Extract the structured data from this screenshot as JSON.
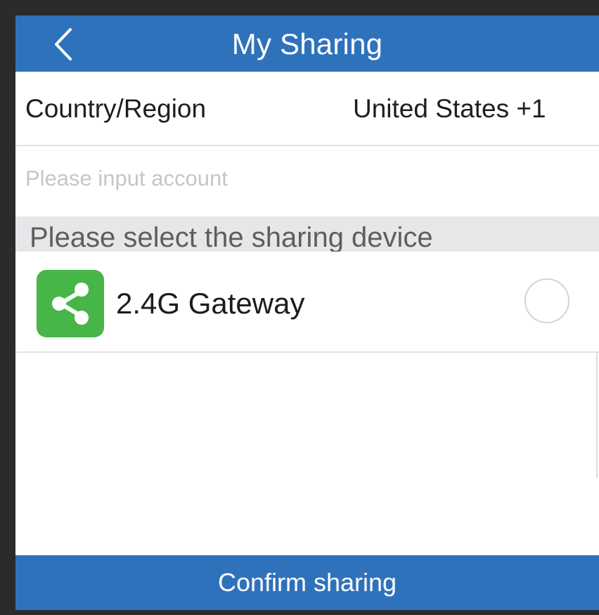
{
  "header": {
    "title": "My Sharing",
    "back_icon": "chevron-left-icon",
    "background_color": "#2f72bc"
  },
  "country": {
    "label": "Country/Region",
    "value": "United States +1"
  },
  "account": {
    "value": "",
    "placeholder": "Please input account"
  },
  "device_section": {
    "title": "Please select the sharing device"
  },
  "devices": [
    {
      "name": "2.4G Gateway",
      "icon": "share-icon",
      "icon_color": "#47b548",
      "selected": false
    }
  ],
  "footer": {
    "confirm_label": "Confirm sharing"
  }
}
